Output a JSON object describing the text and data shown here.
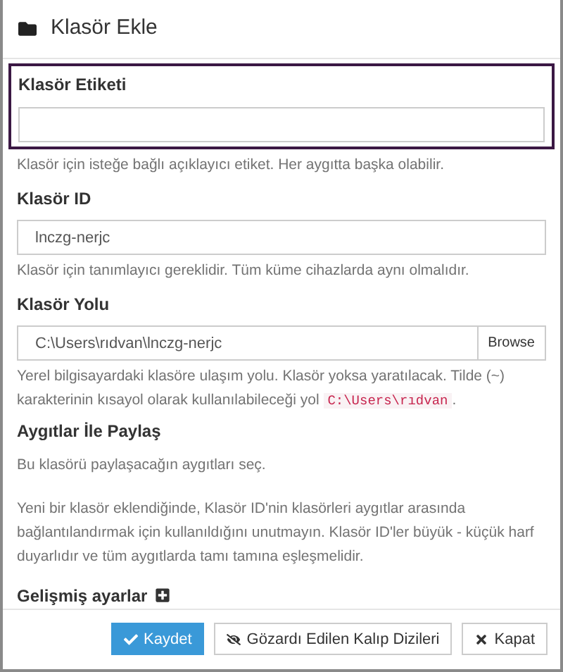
{
  "dialog": {
    "title": "Klasör Ekle"
  },
  "fields": [
    {
      "kind": "text",
      "label": "Klasör Etiketi",
      "focused": true,
      "help": "Klasör için isteğe bağlı açıklayıcı etiket. Her aygıtta başka olabilir."
    },
    {
      "kind": "text",
      "label": "Klasör ID",
      "value": "lnczg-nerjc",
      "focused": false,
      "help": "Klasör için tanımlayıcı gereklidir. Tüm küme cihazlarda aynı olmalıdır."
    },
    {
      "kind": "path",
      "label": "Klasör Yolu",
      "value": "C:\\Users\\rıdvan\\lnczg-nerjc",
      "focused": false,
      "button": "Browse",
      "help": "Yerel bilgisayardaki klasöre ulaşım yolu. Klasör yoksa yaratılacak. Tilde (~) karakterinin kısayol olarak kullanılabileceği yol",
      "help_code": "C:\\Users\\rıdvan",
      "help_end": "."
    }
  ],
  "share": {
    "label": "Aygıtlar İle Paylaş",
    "help": "Bu klasörü paylaşacağın aygıtları seç."
  },
  "note": "Yeni bir klasör eklendiğinde, Klasör ID'nin klasörleri aygıtlar arasında bağlantılandırmak için kullanıldığını unutmayın. Klasör ID'ler büyük - küçük harf duyarlıdır ve tüm aygıtlarda tamı tamına eşleşmelidir.",
  "advanced": {
    "label": "Gelişmiş ayarlar",
    "expanded": false
  },
  "buttons": [
    {
      "kind": "save",
      "label": "Kaydet"
    },
    {
      "kind": "ignore",
      "label": "Gözardı Edilen Kalıp Dizileri"
    },
    {
      "kind": "close",
      "label": "Kapat"
    }
  ]
}
